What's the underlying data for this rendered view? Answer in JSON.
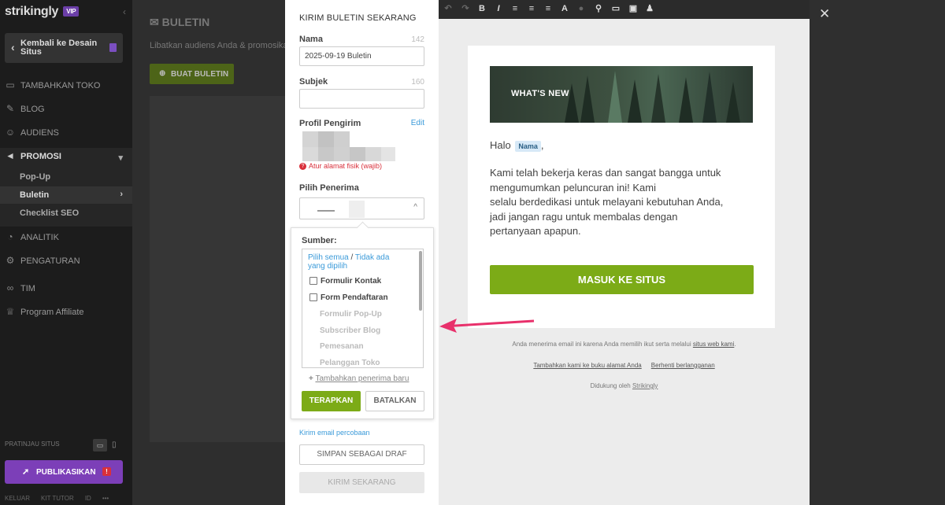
{
  "sidebar": {
    "logo": "strikingly",
    "vip": "VIP",
    "back_label": "Kembali ke Desain Situs",
    "items": [
      {
        "label": "TAMBAHKAN TOKO",
        "icon": "store-icon"
      },
      {
        "label": "BLOG",
        "icon": "pen-icon"
      },
      {
        "label": "AUDIENS",
        "icon": "users-icon"
      },
      {
        "label": "PROMOSI",
        "icon": "megaphone-icon"
      },
      {
        "label": "ANALITIK",
        "icon": "chart-icon"
      },
      {
        "label": "PENGATURAN",
        "icon": "gear-icon"
      },
      {
        "label": "TIM",
        "icon": "team-icon"
      },
      {
        "label": "Program Affiliate",
        "icon": "trophy-icon"
      }
    ],
    "sub_items": [
      "Pop-Up",
      "Buletin",
      "Checklist SEO"
    ],
    "preview_label": "PRATINJAU SITUS",
    "publish_label": "PUBLIKASIKAN",
    "publish_warning": "!",
    "footer": [
      "KELUAR",
      "KIT TUTOR",
      "ID",
      "•••"
    ]
  },
  "main": {
    "title": "BULETIN",
    "subtitle": "Libatkan audiens Anda & promosikan",
    "create_button": "BUAT BULETIN"
  },
  "panel": {
    "title": "KIRIM BULETIN SEKARANG",
    "name_label": "Nama",
    "name_count": "142",
    "name_value": "2025-09-19 Buletin",
    "subject_label": "Subjek",
    "subject_count": "160",
    "subject_value": "",
    "sender_label": "Profil Pengirim",
    "edit_label": "Edit",
    "address_error": "Atur alamat fisik (wajib)",
    "recipients_label": "Pilih Penerima",
    "dropdown": {
      "sources_label": "Sumber:",
      "select_all": "Pilih semua",
      "separator": "/",
      "select_none": "Tidak ada yang dipilih",
      "options_enabled": [
        "Formulir Kontak",
        "Form Pendaftaran"
      ],
      "options_disabled": [
        "Formulir Pop-Up",
        "Subscriber Blog",
        "Pemesanan",
        "Pelanggan Toko"
      ],
      "add_recipient_prefix": "+",
      "add_recipient": "Tambahkan penerima baru",
      "apply": "TERAPKAN",
      "cancel": "BATALKAN"
    },
    "test_email": "Kirim email percobaan",
    "save_draft": "SIMPAN SEBAGAI DRAF",
    "send_now": "KIRIM SEKARANG"
  },
  "preview": {
    "banner_text": "WHAT'S NEW",
    "greeting": "Halo",
    "name_tag": "Nama",
    "greeting_end": ",",
    "body_lines": [
      "Kami telah bekerja keras dan sangat bangga untuk",
      "mengumumkan peluncuran ini! Kami",
      "selalu berdedikasi untuk melayani kebutuhan Anda,",
      "jadi jangan ragu untuk membalas dengan",
      "pertanyaan apapun."
    ],
    "cta": "MASUK KE SITUS",
    "footer_text": "Anda menerima email ini karena Anda memilih ikut serta melalui",
    "footer_link": "situs web kami",
    "footer_period": ".",
    "address_book_link": "Tambahkan kami ke buku alamat Anda",
    "unsubscribe_link": "Berhenti berlangganan",
    "powered_by": "Didukung oleh",
    "powered_brand": "Strikingly"
  },
  "toolbar": {
    "undo": "↶",
    "redo": "↷",
    "bold": "B",
    "italic": "I",
    "font": "A"
  },
  "close": "✕",
  "colors": {
    "accent_green": "#7cab17",
    "link_blue": "#3a9ad9",
    "error_red": "#d9303b",
    "publish_purple": "#7c3fb8",
    "arrow_pink": "#e8306b"
  }
}
